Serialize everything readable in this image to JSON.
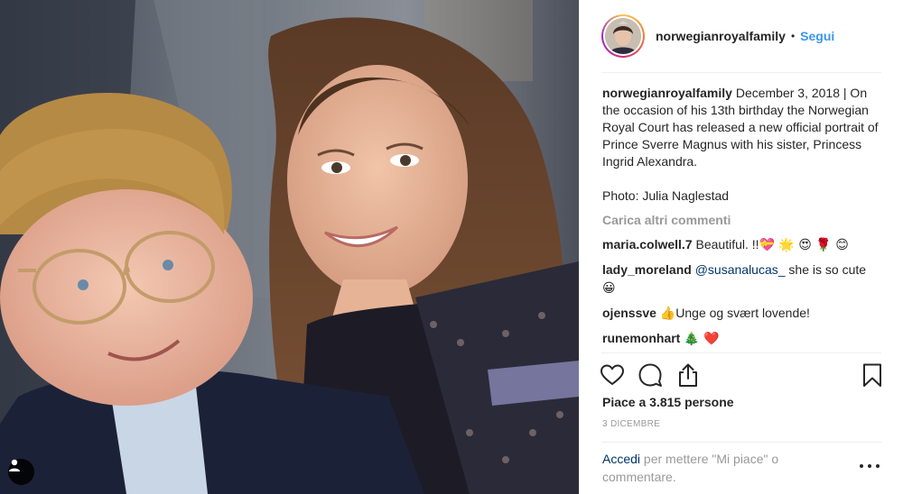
{
  "header": {
    "username": "norwegianroyalfamily",
    "separator": "•",
    "follow_label": "Segui"
  },
  "caption": {
    "username": "norwegianroyalfamily",
    "text": "December 3, 2018 | On the occasion of his 13th birthday the Norwegian Royal Court has released a new official portrait of Prince Sverre Magnus with his sister, Princess Ingrid Alexandra.",
    "photo_credit": "Photo: Julia Naglestad"
  },
  "load_more_label": "Carica altri commenti",
  "comments": [
    {
      "username": "maria.colwell.7",
      "text": "Beautiful. !!",
      "emoji": "💝 🌟 😍 🌹 😊"
    },
    {
      "username": "lady_moreland",
      "mention": "@susanalucas_",
      "text": " she is so cute ",
      "emoji": "😀"
    },
    {
      "username": "ojenssve",
      "emoji": "👍",
      "text": "Unge og svært lovende!"
    },
    {
      "username": "runemonhart",
      "emoji": "🎄 ❤️"
    }
  ],
  "likes_label": "Piace a 3.815 persone",
  "date_label": "3 DICEMBRE",
  "login": {
    "link_label": "Accedi",
    "rest_label": " per mettere \"Mi piace\" o commentare."
  },
  "icons": {
    "like": "heart-icon",
    "comment": "comment-bubble-icon",
    "share": "share-icon",
    "save": "bookmark-icon",
    "more": "more-options-icon",
    "user_tags": "person-icon"
  },
  "colors": {
    "link_blue": "#3897f0",
    "mention_navy": "#003569",
    "muted_gray": "#999999"
  }
}
